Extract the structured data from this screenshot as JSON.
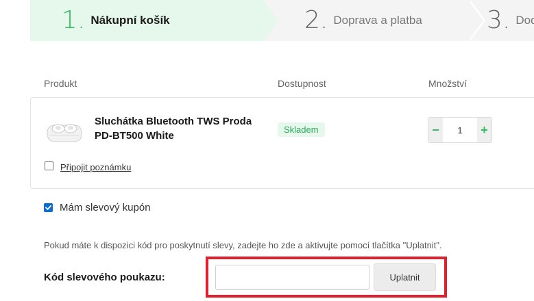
{
  "steps": [
    {
      "number": "1.",
      "label": "Nákupní košík"
    },
    {
      "number": "2.",
      "label": "Doprava a platba"
    },
    {
      "number": "3.",
      "label": "Dod"
    }
  ],
  "table": {
    "headers": {
      "product": "Produkt",
      "availability": "Dostupnost",
      "quantity": "Množství"
    }
  },
  "product": {
    "name": "Sluchátka Bluetooth TWS Proda PD-BT500 White",
    "availability": "Skladem",
    "quantity": "1",
    "minus": "−",
    "plus": "+",
    "note_link": "Připojit poznámku",
    "note_checked": false
  },
  "coupon": {
    "checkbox_label": "Mám slevový kupón",
    "checked": true,
    "info": "Pokud máte k dispozici kód pro poskytnutí slevy, zadejte ho zde a aktivujte pomocí tlačítka \"Uplatnit\".",
    "code_label": "Kód slevového poukazu:",
    "code_value": "",
    "apply_label": "Uplatnit"
  },
  "colors": {
    "accent_green": "#2fbf5f",
    "highlight_red": "#e0202d",
    "checkbox_blue": "#0b6cd4"
  }
}
